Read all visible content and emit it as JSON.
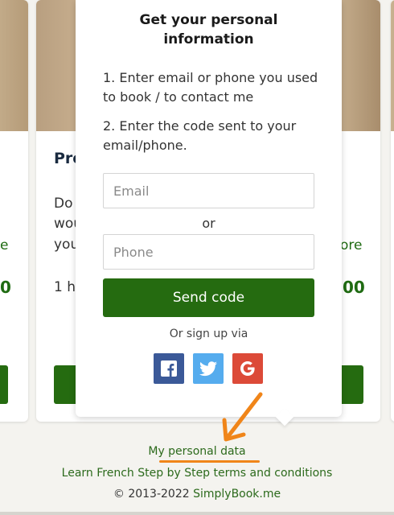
{
  "popup": {
    "title": "Get your personal information",
    "step1": "1. Enter email or phone you used to book / to contact me",
    "step2": "2. Enter the code sent to your email/phone.",
    "email_placeholder": "Email",
    "or_label": "or",
    "phone_placeholder": "Phone",
    "send_button": "Send code",
    "signup_label": "Or sign up via",
    "social": [
      {
        "icon": "facebook-icon",
        "color": "#3b5998"
      },
      {
        "icon": "twitter-icon",
        "color": "#55acee"
      },
      {
        "icon": "google-icon",
        "color": "#dc4a38"
      }
    ]
  },
  "background": {
    "card_title_fragment": "Pre",
    "desc_line1": "Do",
    "desc_line2": "wou",
    "desc_line3": "you",
    "duration_fragment": "1 h",
    "left_more_fragment": "e",
    "left_price_fragment": "0",
    "right_more_fragment": "ore",
    "right_price_fragment": "00"
  },
  "footer": {
    "personal_data_link": "My personal data",
    "terms_link": "Learn French Step by Step terms and conditions",
    "copyright_prefix": "© 2013-2022 ",
    "copyright_link": "SimplyBook.me"
  },
  "colors": {
    "primary_green": "#256b10",
    "annotation_orange": "#f08519"
  }
}
